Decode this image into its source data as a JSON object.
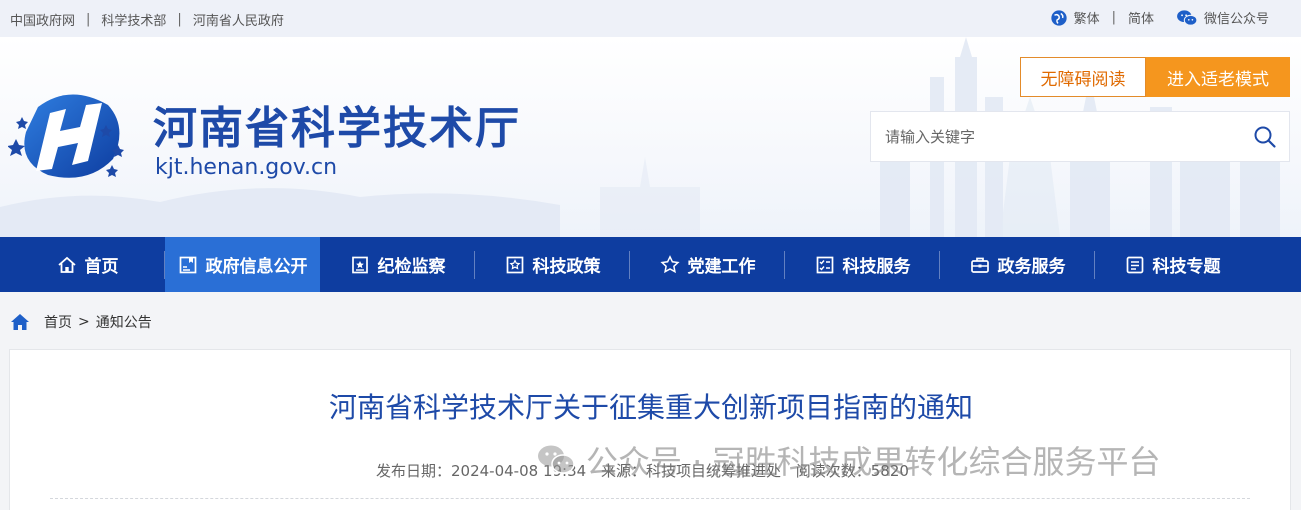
{
  "topbar": {
    "links": [
      "中国政府网",
      "科学技术部",
      "河南省人民政府"
    ],
    "separator": "|",
    "traditional": "繁体",
    "simplified": "简体",
    "wechat": "微信公众号"
  },
  "header": {
    "site_title": "河南省科学技术厅",
    "domain": "kjt.henan.gov.cn",
    "accessible_read": "无障碍阅读",
    "elder_mode": "进入适老模式",
    "search_placeholder": "请输入关键字"
  },
  "nav": {
    "items": [
      {
        "label": "首页",
        "icon": "home-icon"
      },
      {
        "label": "政府信息公开",
        "icon": "info-disclosure-icon"
      },
      {
        "label": "纪检监察",
        "icon": "inspection-icon"
      },
      {
        "label": "科技政策",
        "icon": "policy-icon"
      },
      {
        "label": "党建工作",
        "icon": "star-icon"
      },
      {
        "label": "科技服务",
        "icon": "checklist-icon"
      },
      {
        "label": "政务服务",
        "icon": "briefcase-icon"
      },
      {
        "label": "科技专题",
        "icon": "topic-list-icon"
      }
    ],
    "active_index": 1
  },
  "breadcrumb": {
    "home": "首页",
    "separator": ">",
    "current": "通知公告"
  },
  "article": {
    "title": "河南省科学技术厅关于征集重大创新项目指南的通知",
    "publish_label": "发布日期：2024-04-08 19:34",
    "source_label": "来源：科技项目统筹推进处",
    "views_label": "阅读次数：5820"
  },
  "watermark": {
    "text": "公众号 · 冠胜科技成果转化综合服务平台"
  },
  "colors": {
    "brand_blue": "#1e4aa8",
    "nav_bg": "#0e3da0",
    "nav_active": "#2a6fd6",
    "orange": "#f5961e"
  }
}
